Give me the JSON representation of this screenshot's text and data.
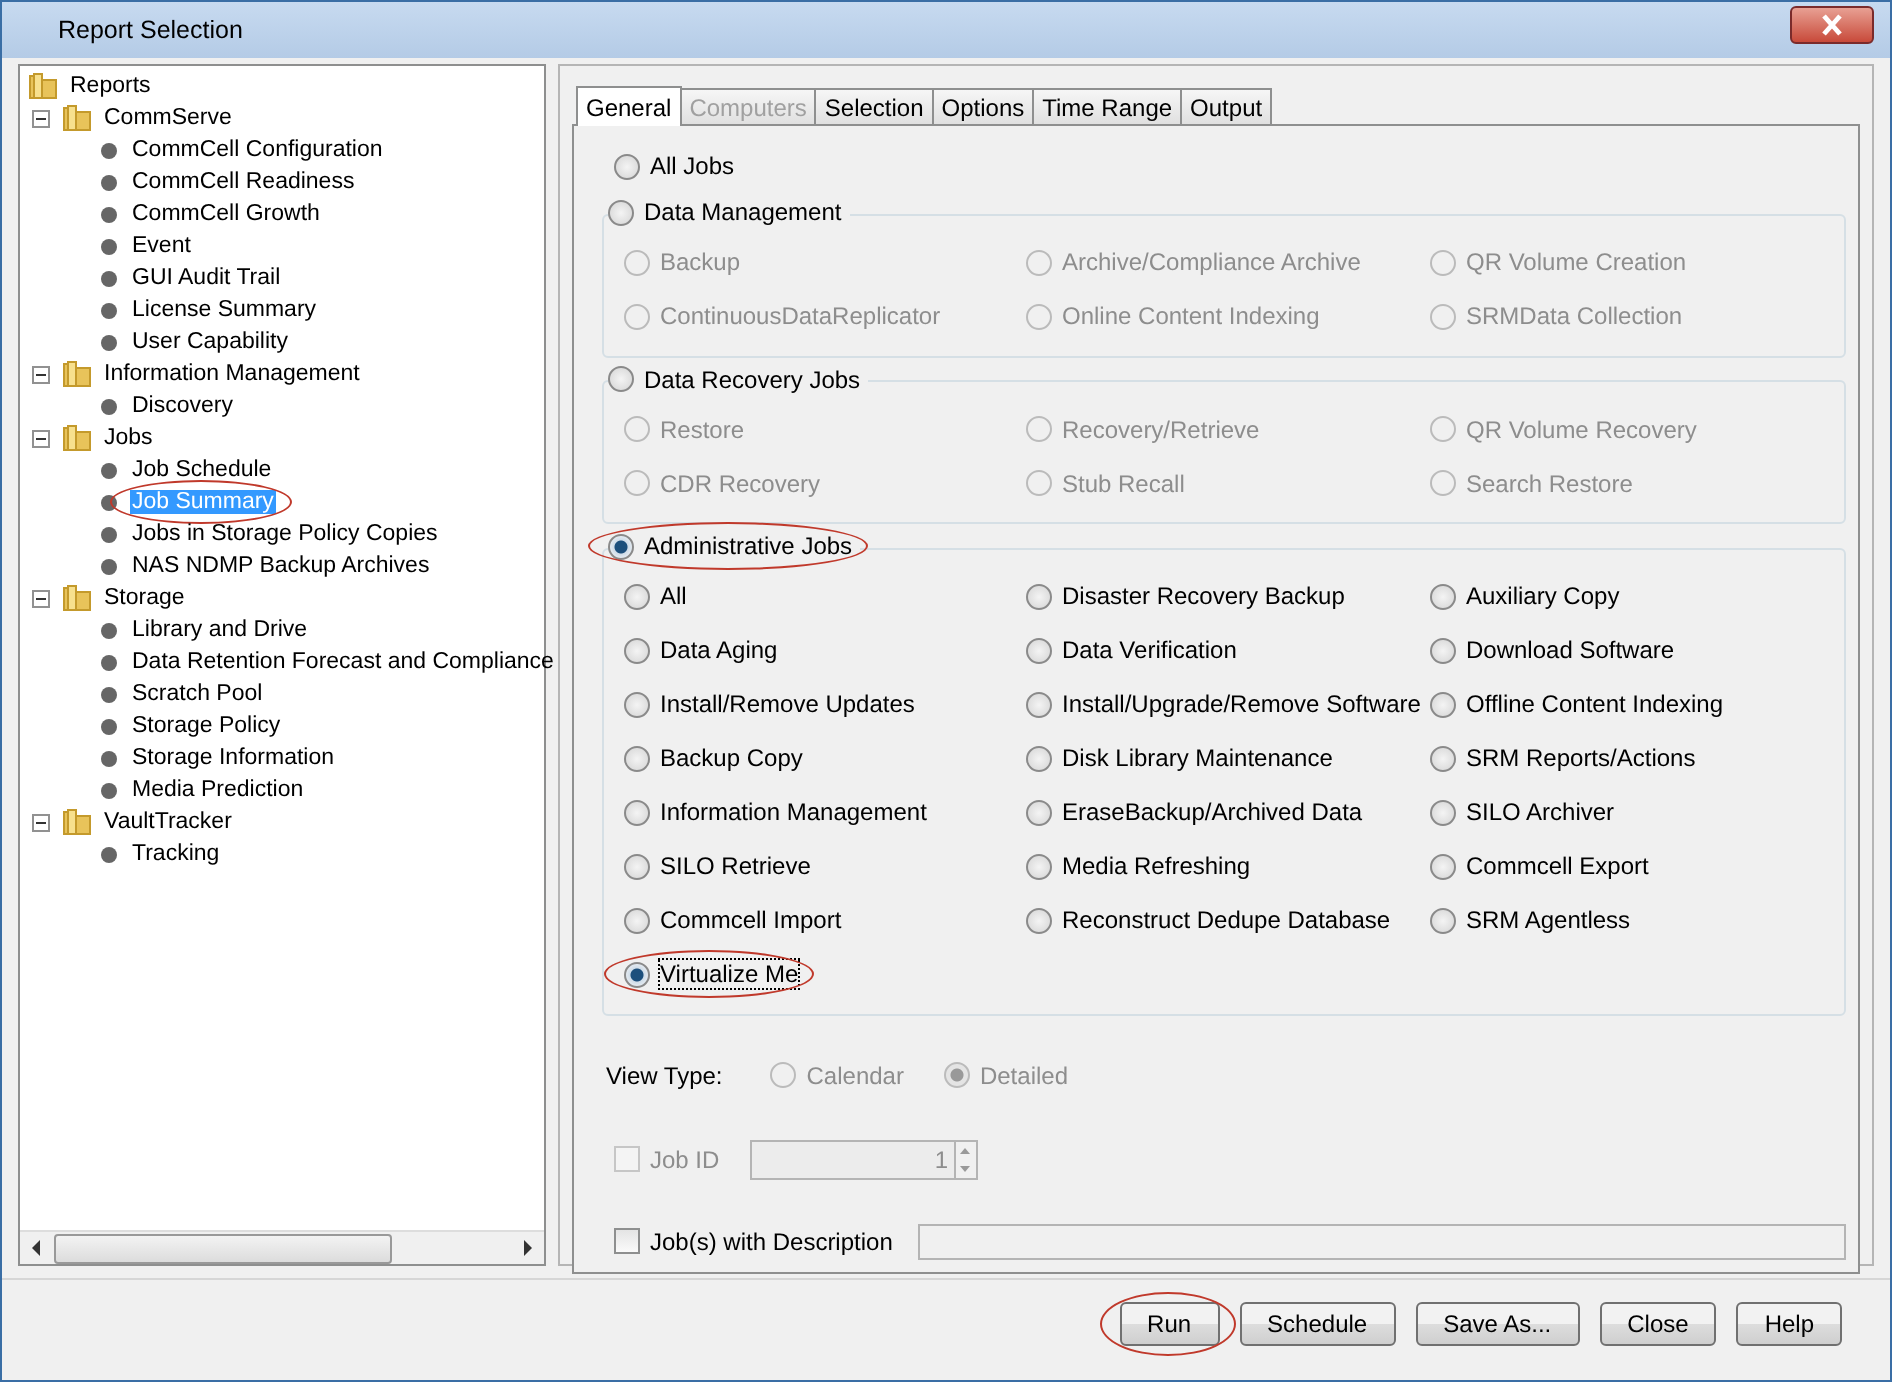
{
  "window": {
    "title": "Report Selection"
  },
  "tree": {
    "label": "Reports",
    "children": [
      {
        "label": "CommServe",
        "expanded": true,
        "children": [
          {
            "label": "CommCell Configuration",
            "selected": false,
            "circled": false
          },
          {
            "label": "CommCell Readiness",
            "selected": false,
            "circled": false
          },
          {
            "label": "CommCell Growth",
            "selected": false,
            "circled": false
          },
          {
            "label": "Event",
            "selected": false,
            "circled": false
          },
          {
            "label": "GUI Audit Trail",
            "selected": false,
            "circled": false
          },
          {
            "label": "License Summary",
            "selected": false,
            "circled": false
          },
          {
            "label": "User Capability",
            "selected": false,
            "circled": false
          }
        ]
      },
      {
        "label": "Information Management",
        "expanded": true,
        "children": [
          {
            "label": "Discovery",
            "selected": false,
            "circled": false
          }
        ]
      },
      {
        "label": "Jobs",
        "expanded": true,
        "children": [
          {
            "label": "Job Schedule",
            "selected": false,
            "circled": false
          },
          {
            "label": "Job Summary",
            "selected": true,
            "circled": true
          },
          {
            "label": "Jobs in Storage Policy Copies",
            "selected": false,
            "circled": false
          },
          {
            "label": "NAS NDMP Backup Archives",
            "selected": false,
            "circled": false
          }
        ]
      },
      {
        "label": "Storage",
        "expanded": true,
        "children": [
          {
            "label": "Library and Drive",
            "selected": false,
            "circled": false
          },
          {
            "label": "Data Retention Forecast and Compliance",
            "selected": false,
            "circled": false
          },
          {
            "label": "Scratch Pool",
            "selected": false,
            "circled": false
          },
          {
            "label": "Storage Policy",
            "selected": false,
            "circled": false
          },
          {
            "label": "Storage Information",
            "selected": false,
            "circled": false
          },
          {
            "label": "Media Prediction",
            "selected": false,
            "circled": false
          }
        ]
      },
      {
        "label": "VaultTracker",
        "expanded": true,
        "children": [
          {
            "label": "Tracking",
            "selected": false,
            "circled": false
          }
        ]
      }
    ]
  },
  "tabs": [
    {
      "label": "General",
      "selected": true,
      "disabled": false
    },
    {
      "label": "Computers",
      "selected": false,
      "disabled": true
    },
    {
      "label": "Selection",
      "selected": false,
      "disabled": false
    },
    {
      "label": "Options",
      "selected": false,
      "disabled": false
    },
    {
      "label": "Time Range",
      "selected": false,
      "disabled": false
    },
    {
      "label": "Output",
      "selected": false,
      "disabled": false
    }
  ],
  "all_jobs": {
    "label": "All Jobs",
    "selected": false
  },
  "groups": [
    {
      "label": "Data Management",
      "selected": false,
      "circled": false,
      "items": [
        {
          "label": "Backup",
          "selected": false,
          "disabled": true,
          "circled": false
        },
        {
          "label": "Archive/Compliance Archive",
          "selected": false,
          "disabled": true,
          "circled": false
        },
        {
          "label": "QR Volume Creation",
          "selected": false,
          "disabled": true,
          "circled": false
        },
        {
          "label": "ContinuousDataReplicator",
          "selected": false,
          "disabled": true,
          "circled": false
        },
        {
          "label": "Online Content Indexing",
          "selected": false,
          "disabled": true,
          "circled": false
        },
        {
          "label": "SRMData Collection",
          "selected": false,
          "disabled": true,
          "circled": false
        }
      ]
    },
    {
      "label": "Data Recovery Jobs",
      "selected": false,
      "circled": false,
      "items": [
        {
          "label": "Restore",
          "selected": false,
          "disabled": true,
          "circled": false
        },
        {
          "label": "Recovery/Retrieve",
          "selected": false,
          "disabled": true,
          "circled": false
        },
        {
          "label": "QR Volume Recovery",
          "selected": false,
          "disabled": true,
          "circled": false
        },
        {
          "label": "CDR Recovery",
          "selected": false,
          "disabled": true,
          "circled": false
        },
        {
          "label": "Stub Recall",
          "selected": false,
          "disabled": true,
          "circled": false
        },
        {
          "label": "Search Restore",
          "selected": false,
          "disabled": true,
          "circled": false
        }
      ]
    },
    {
      "label": "Administrative Jobs",
      "selected": true,
      "circled": true,
      "items": [
        {
          "label": "All",
          "selected": false,
          "disabled": false,
          "circled": false
        },
        {
          "label": "Disaster Recovery Backup",
          "selected": false,
          "disabled": false,
          "circled": false
        },
        {
          "label": "Auxiliary Copy",
          "selected": false,
          "disabled": false,
          "circled": false
        },
        {
          "label": "Data Aging",
          "selected": false,
          "disabled": false,
          "circled": false
        },
        {
          "label": "Data Verification",
          "selected": false,
          "disabled": false,
          "circled": false
        },
        {
          "label": "Download Software",
          "selected": false,
          "disabled": false,
          "circled": false
        },
        {
          "label": "Install/Remove Updates",
          "selected": false,
          "disabled": false,
          "circled": false
        },
        {
          "label": "Install/Upgrade/Remove Software",
          "selected": false,
          "disabled": false,
          "circled": false
        },
        {
          "label": "Offline Content Indexing",
          "selected": false,
          "disabled": false,
          "circled": false
        },
        {
          "label": "Backup Copy",
          "selected": false,
          "disabled": false,
          "circled": false
        },
        {
          "label": "Disk Library Maintenance",
          "selected": false,
          "disabled": false,
          "circled": false
        },
        {
          "label": "SRM Reports/Actions",
          "selected": false,
          "disabled": false,
          "circled": false
        },
        {
          "label": "Information Management",
          "selected": false,
          "disabled": false,
          "circled": false
        },
        {
          "label": "EraseBackup/Archived Data",
          "selected": false,
          "disabled": false,
          "circled": false
        },
        {
          "label": "SILO Archiver",
          "selected": false,
          "disabled": false,
          "circled": false
        },
        {
          "label": "SILO Retrieve",
          "selected": false,
          "disabled": false,
          "circled": false
        },
        {
          "label": "Media Refreshing",
          "selected": false,
          "disabled": false,
          "circled": false
        },
        {
          "label": "Commcell Export",
          "selected": false,
          "disabled": false,
          "circled": false
        },
        {
          "label": "Commcell Import",
          "selected": false,
          "disabled": false,
          "circled": false
        },
        {
          "label": "Reconstruct Dedupe Database",
          "selected": false,
          "disabled": false,
          "circled": false
        },
        {
          "label": "SRM Agentless",
          "selected": false,
          "disabled": false,
          "circled": false
        },
        {
          "label": "Virtualize Me",
          "selected": true,
          "disabled": false,
          "circled": true
        }
      ]
    }
  ],
  "view_type": {
    "label": "View Type:",
    "options": [
      {
        "label": "Calendar",
        "selected": false,
        "disabled": true
      },
      {
        "label": "Detailed",
        "selected": true,
        "disabled": true
      }
    ]
  },
  "job_id": {
    "label": "Job ID",
    "checked": false,
    "disabled": true,
    "value": "1"
  },
  "description": {
    "label": "Job(s) with Description",
    "checked": false,
    "disabled": false
  },
  "buttons": [
    {
      "label": "Run",
      "circled": true
    },
    {
      "label": "Schedule",
      "circled": false
    },
    {
      "label": "Save As...",
      "circled": false
    },
    {
      "label": "Close",
      "circled": false
    },
    {
      "label": "Help",
      "circled": false
    }
  ]
}
